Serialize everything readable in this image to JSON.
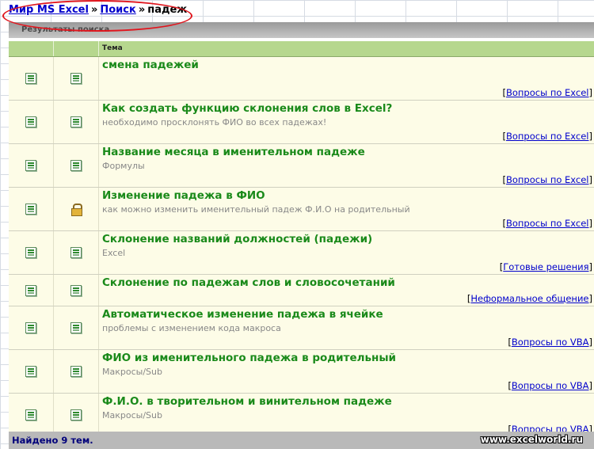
{
  "breadcrumb": {
    "home": "Мир MS Excel",
    "search": "Поиск",
    "current": "падеж",
    "separator": "»"
  },
  "panel": {
    "header": "Результаты поиска",
    "column_topic": "Тема",
    "footer": "Найдено 9 тем."
  },
  "rows": [
    {
      "title": "смена падежей",
      "desc": "",
      "category": "Вопросы по Excel",
      "icon1": "excel-file-icon",
      "icon2": "excel-file-icon"
    },
    {
      "title": "Как создать функцию склонения слов в Excel?",
      "desc": "необходимо просклонять ФИО во всех падежах!",
      "category": "Вопросы по Excel",
      "icon1": "excel-file-icon",
      "icon2": "excel-file-icon"
    },
    {
      "title": "Название месяца в именительном падеже",
      "desc": "Формулы",
      "category": "Вопросы по Excel",
      "icon1": "excel-file-icon",
      "icon2": "excel-file-icon"
    },
    {
      "title": "Изменение падежа в ФИО",
      "desc": "как можно изменить именительный падеж Ф.И.О на родительный",
      "category": "Вопросы по Excel",
      "icon1": "excel-file-icon",
      "icon2": "lock-icon"
    },
    {
      "title": "Склонение названий должностей (падежи)",
      "desc": "Excel",
      "category": "Готовые решения",
      "icon1": "excel-file-icon",
      "icon2": "excel-file-icon"
    },
    {
      "title": "Склонение по падежам слов и словосочетаний",
      "desc": "",
      "category": "Неформальное общение",
      "icon1": "excel-file-icon",
      "icon2": "excel-file-icon"
    },
    {
      "title": "Автоматическое изменение падежа в ячейке",
      "desc": "проблемы с изменением кода макроса",
      "category": "Вопросы по VBA",
      "icon1": "excel-file-icon",
      "icon2": "excel-file-icon"
    },
    {
      "title": "ФИО из именительного падежа в родительный",
      "desc": "Макросы/Sub",
      "category": "Вопросы по VBA",
      "icon1": "excel-file-icon",
      "icon2": "excel-file-icon"
    },
    {
      "title": "Ф.И.О. в творительном и винительном падеже",
      "desc": "Макросы/Sub",
      "category": "Вопросы по VBA",
      "icon1": "excel-file-icon",
      "icon2": "excel-file-icon"
    }
  ],
  "watermark": "www.excelworld.ru",
  "colors": {
    "title_green": "#1a8a1a",
    "link_blue": "#0000cc",
    "oval_red": "#e0161e",
    "header_green": "#b6d78e",
    "row_bg": "#fdfce7"
  }
}
